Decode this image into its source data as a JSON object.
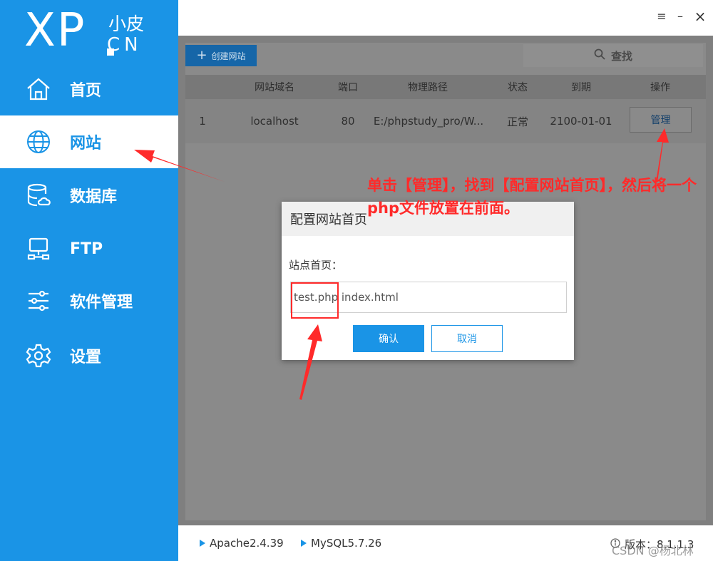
{
  "logo": {
    "main": "XP",
    "cn_top": "小皮",
    "cn_bottom": "CN"
  },
  "sidebar": {
    "items": [
      {
        "label": "首页",
        "icon": "home-icon"
      },
      {
        "label": "网站",
        "icon": "globe-icon",
        "active": true
      },
      {
        "label": "数据库",
        "icon": "database-icon"
      },
      {
        "label": "FTP",
        "icon": "ftp-server-icon"
      },
      {
        "label": "软件管理",
        "icon": "sliders-icon"
      },
      {
        "label": "设置",
        "icon": "gear-icon"
      }
    ]
  },
  "window_controls": {
    "menu": "≡",
    "minimize": "–",
    "close": "×"
  },
  "toolbar": {
    "create_label": "创建网站",
    "search_label": "查找"
  },
  "table": {
    "headers": [
      "网站域名",
      "端口",
      "物理路径",
      "状态",
      "到期",
      "操作"
    ],
    "rows": [
      {
        "index": "1",
        "domain": "localhost",
        "port": "80",
        "path": "E:/phpstudy_pro/W...",
        "status": "正常",
        "expiry": "2100-01-01",
        "action": "管理"
      }
    ]
  },
  "dialog": {
    "title": "配置网站首页",
    "label": "站点首页：",
    "input_value": "test.php index.html",
    "ok_label": "确认",
    "cancel_label": "取消"
  },
  "annotation": {
    "text": "单击【管理】，找到【配置网站首页】，然后将一个php文件放置在前面。",
    "color": "#ff2a2a"
  },
  "statusbar": {
    "apache": "Apache2.4.39",
    "mysql": "MySQL5.7.26",
    "version": "版本：8.1.1.3",
    "watermark": "CSDN @杨北林"
  },
  "colors": {
    "primary": "#1a94e6",
    "annotation": "#ff2a2a"
  }
}
